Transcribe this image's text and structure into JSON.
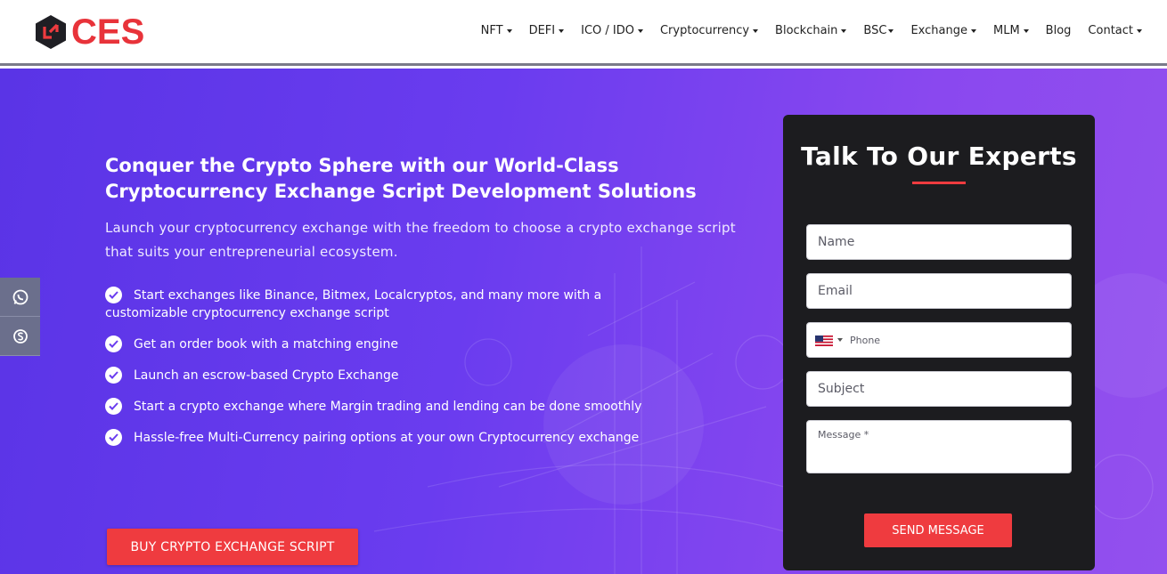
{
  "brand": {
    "name": "CES",
    "accent": "#ef3b3f"
  },
  "nav": {
    "items": [
      {
        "label": "NFT",
        "dropdown": true
      },
      {
        "label": "DEFI",
        "dropdown": true
      },
      {
        "label": "ICO / IDO",
        "dropdown": true
      },
      {
        "label": "Cryptocurrency",
        "dropdown": true
      },
      {
        "label": "Blockchain",
        "dropdown": true
      },
      {
        "label": "BSC",
        "dropdown": true
      },
      {
        "label": "Exchange",
        "dropdown": true
      },
      {
        "label": "MLM",
        "dropdown": true
      },
      {
        "label": "Blog",
        "dropdown": false
      },
      {
        "label": "Contact",
        "dropdown": true
      }
    ]
  },
  "hero": {
    "title_line1": "Conquer the Crypto Sphere with our World-Class",
    "title_line2": "Cryptocurrency Exchange Script Development Solutions",
    "subtitle": "Launch your cryptocurrency exchange with the freedom to choose a crypto exchange script that suits your entrepreneurial ecosystem.",
    "bullets": [
      "Start exchanges like Binance, Bitmex, Localcryptos, and many more with a customizable cryptocurrency exchange script",
      "Get an order book with a matching engine",
      "Launch an escrow-based Crypto Exchange",
      "Start a crypto exchange where Margin trading and lending can be done smoothly",
      "Hassle-free Multi-Currency pairing options at your own Cryptocurrency exchange"
    ],
    "cta_label": "BUY CRYPTO EXCHANGE SCRIPT"
  },
  "side_social": [
    {
      "icon": "whatsapp-icon"
    },
    {
      "icon": "skype-icon"
    }
  ],
  "form": {
    "title": "Talk To Our Experts",
    "name_placeholder": "Name",
    "email_placeholder": "Email",
    "phone_placeholder": "Phone",
    "phone_country_flag": "us-flag-icon",
    "subject_placeholder": "Subject",
    "message_placeholder": "Message *",
    "submit_label": "SEND MESSAGE"
  }
}
